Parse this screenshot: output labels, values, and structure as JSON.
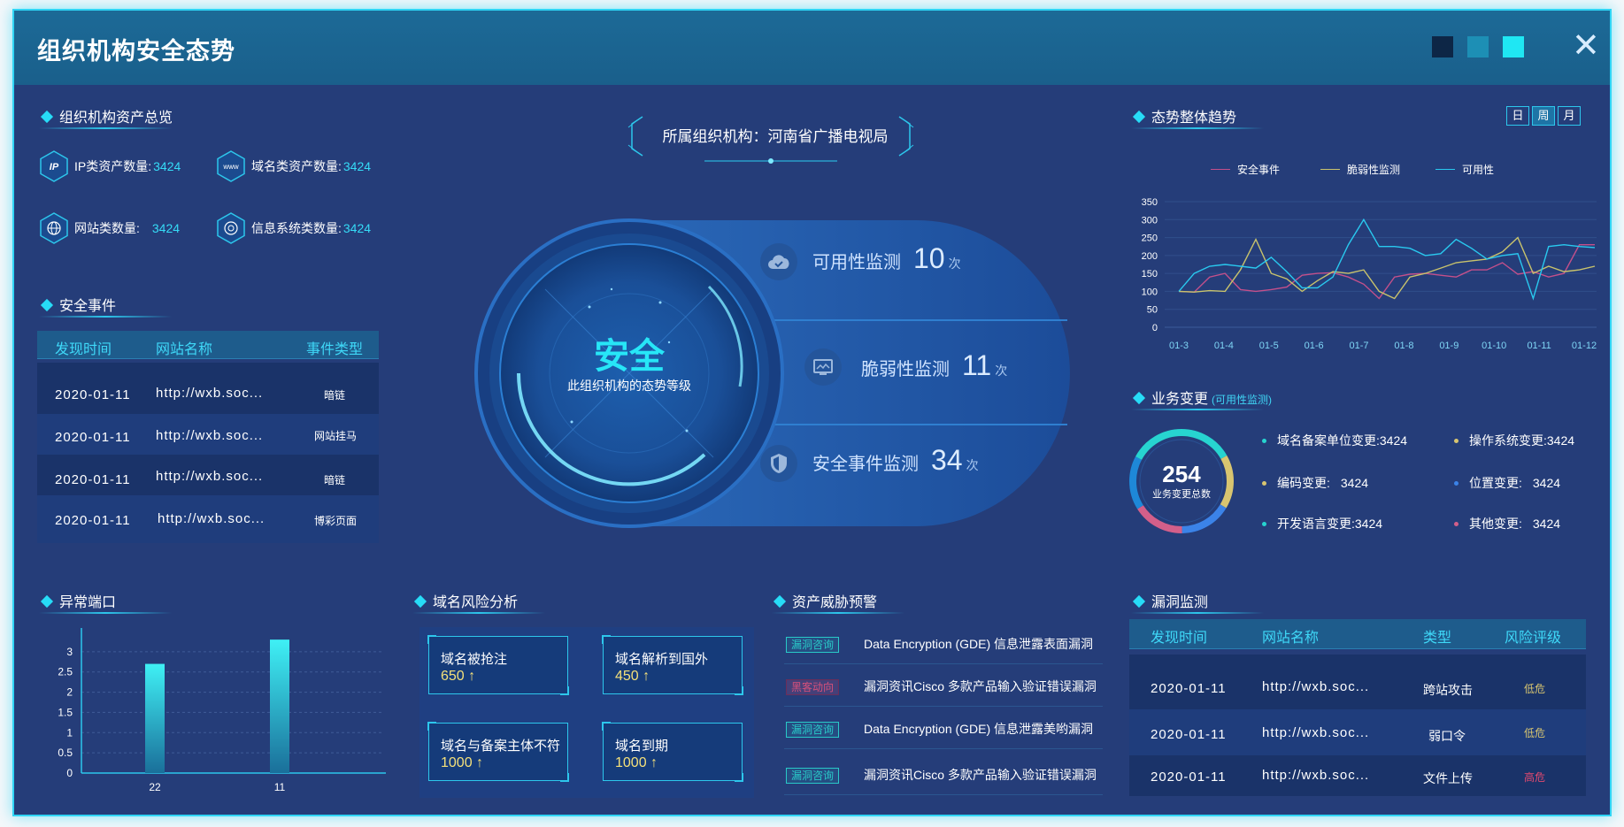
{
  "window": {
    "title": "组织机构安全态势",
    "theme_colors": [
      "#0d2646",
      "#1d8fb5",
      "#1fe7f3"
    ],
    "close_icon": "close-icon"
  },
  "assets": {
    "title": "组织机构资产总览",
    "items": [
      {
        "label": "IP类资产数量:",
        "value": "3424",
        "icon": "ip-icon"
      },
      {
        "label": "域名类资产数量:",
        "value": "3424",
        "icon": "www-icon"
      },
      {
        "label": "网站类数量:",
        "value": "3424",
        "icon": "globe-icon"
      },
      {
        "label": "信息系统类数量:",
        "value": "3424",
        "icon": "system-icon"
      }
    ]
  },
  "security_events": {
    "title": "安全事件",
    "headers": [
      "发现时间",
      "网站名称",
      "事件类型"
    ],
    "rows": [
      {
        "time": "2020-01-11",
        "site": "http://wxb.soc...",
        "type": "暗链"
      },
      {
        "time": "2020-01-11",
        "site": "http://wxb.soc...",
        "type": "网站挂马"
      },
      {
        "time": "2020-01-11",
        "site": "http://wxb.soc...",
        "type": "暗链"
      },
      {
        "time": "2020-01-11",
        "site": "http://wxb.soc...",
        "type": "博彩页面"
      }
    ]
  },
  "center": {
    "org_label": "所属组织机构：河南省广播电视局",
    "level": "安全",
    "level_caption": "此组织机构的态势等级",
    "monitors": [
      {
        "label": "可用性监测",
        "count": "10",
        "unit": "次",
        "icon": "cloud-check-icon"
      },
      {
        "label": "脆弱性监测",
        "count": "11",
        "unit": "次",
        "icon": "monitor-icon"
      },
      {
        "label": "安全事件监测",
        "count": "34",
        "unit": "次",
        "icon": "shield-icon"
      }
    ]
  },
  "trend": {
    "title": "态势整体趋势",
    "periods": [
      "日",
      "周",
      "月"
    ],
    "active_period": "周"
  },
  "chart_data": [
    {
      "type": "line",
      "legend": [
        "安全事件",
        "脆弱性监测",
        "可用性"
      ],
      "x": [
        "01-3",
        "01-4",
        "01-5",
        "01-6",
        "01-7",
        "01-8",
        "01-9",
        "01-10",
        "01-11",
        "01-12"
      ],
      "ylim": [
        0,
        350
      ],
      "yticks": [
        0,
        50,
        100,
        150,
        200,
        250,
        300,
        350
      ],
      "grid": true,
      "colors": [
        "#c4508b",
        "#c9c36c",
        "#29c9ef"
      ],
      "series": [
        {
          "name": "安全事件",
          "values": [
            100,
            98,
            140,
            150,
            105,
            100,
            105,
            112,
            145,
            150,
            152,
            140,
            120,
            80,
            140,
            148,
            150,
            145,
            140,
            160,
            160,
            180,
            148,
            155,
            140,
            150,
            230,
            230
          ]
        },
        {
          "name": "脆弱性监测",
          "values": [
            100,
            98,
            102,
            100,
            160,
            245,
            150,
            135,
            100,
            130,
            155,
            150,
            160,
            100,
            80,
            140,
            150,
            165,
            180,
            185,
            190,
            210,
            250,
            150,
            170,
            155,
            160,
            170
          ]
        },
        {
          "name": "可用性",
          "values": [
            100,
            150,
            170,
            175,
            170,
            165,
            195,
            155,
            110,
            110,
            140,
            230,
            300,
            225,
            225,
            220,
            200,
            205,
            245,
            220,
            190,
            200,
            205,
            80,
            225,
            230,
            225,
            222
          ]
        }
      ]
    },
    {
      "type": "bar",
      "categories": [
        "22",
        "11"
      ],
      "values": [
        2.7,
        3.3
      ],
      "ylim": [
        0,
        3.5
      ],
      "yticks": [
        0,
        0.5,
        1,
        1.5,
        2,
        2.5,
        3
      ]
    }
  ],
  "business_change": {
    "title": "业务变更",
    "subtitle": "(可用性监测)",
    "total": "254",
    "total_label": "业务变更总数",
    "items": [
      {
        "label": "域名备案单位变更:",
        "value": "3424",
        "color": "#27d4d0"
      },
      {
        "label": "操作系统变更:",
        "value": "3424",
        "color": "#d8c570"
      },
      {
        "label": "编码变更:",
        "value": "3424",
        "color": "#d8c570"
      },
      {
        "label": "位置变更:",
        "value": "3424",
        "color": "#3b83e8"
      },
      {
        "label": "开发语言变更:",
        "value": "3424",
        "color": "#27d4d0"
      },
      {
        "label": "其他变更:",
        "value": "3424",
        "color": "#d35f8a"
      }
    ]
  },
  "abnormal_ports": {
    "title": "异常端口"
  },
  "domain_risk": {
    "title": "域名风险分析",
    "items": [
      {
        "label": "域名被抢注",
        "value": "650 ↑"
      },
      {
        "label": "域名解析到国外",
        "value": "450 ↑"
      },
      {
        "label": "域名与备案主体不符",
        "value": "1000 ↑"
      },
      {
        "label": "域名到期",
        "value": "1000 ↑"
      }
    ]
  },
  "threat_alert": {
    "title": "资产威胁预警",
    "items": [
      {
        "tag": "漏洞咨询",
        "text": "Data Encryption (GDE) 信息泄露表面漏洞",
        "tag_color": "#29c9c8"
      },
      {
        "tag": "黑客动向",
        "text": "漏洞资讯Cisco 多款产品输入验证错误漏洞",
        "tag_color": "#d8507a"
      },
      {
        "tag": "漏洞咨询",
        "text": "Data Encryption (GDE) 信息泄露美哟漏洞",
        "tag_color": "#29c9c8"
      },
      {
        "tag": "漏洞咨询",
        "text": "漏洞资讯Cisco 多款产品输入验证错误漏洞",
        "tag_color": "#29c9c8"
      }
    ]
  },
  "vuln_monitor": {
    "title": "漏洞监测",
    "headers": [
      "发现时间",
      "网站名称",
      "类型",
      "风险评级"
    ],
    "rows": [
      {
        "time": "2020-01-11",
        "site": "http://wxb.soc...",
        "type": "跨站攻击",
        "level": "低危",
        "level_color": "#d8c570"
      },
      {
        "time": "2020-01-11",
        "site": "http://wxb.soc...",
        "type": "弱口令",
        "level": "低危",
        "level_color": "#d8c570"
      },
      {
        "time": "2020-01-11",
        "site": "http://wxb.soc...",
        "type": "文件上传",
        "level": "高危",
        "level_color": "#e34a6f"
      }
    ]
  }
}
